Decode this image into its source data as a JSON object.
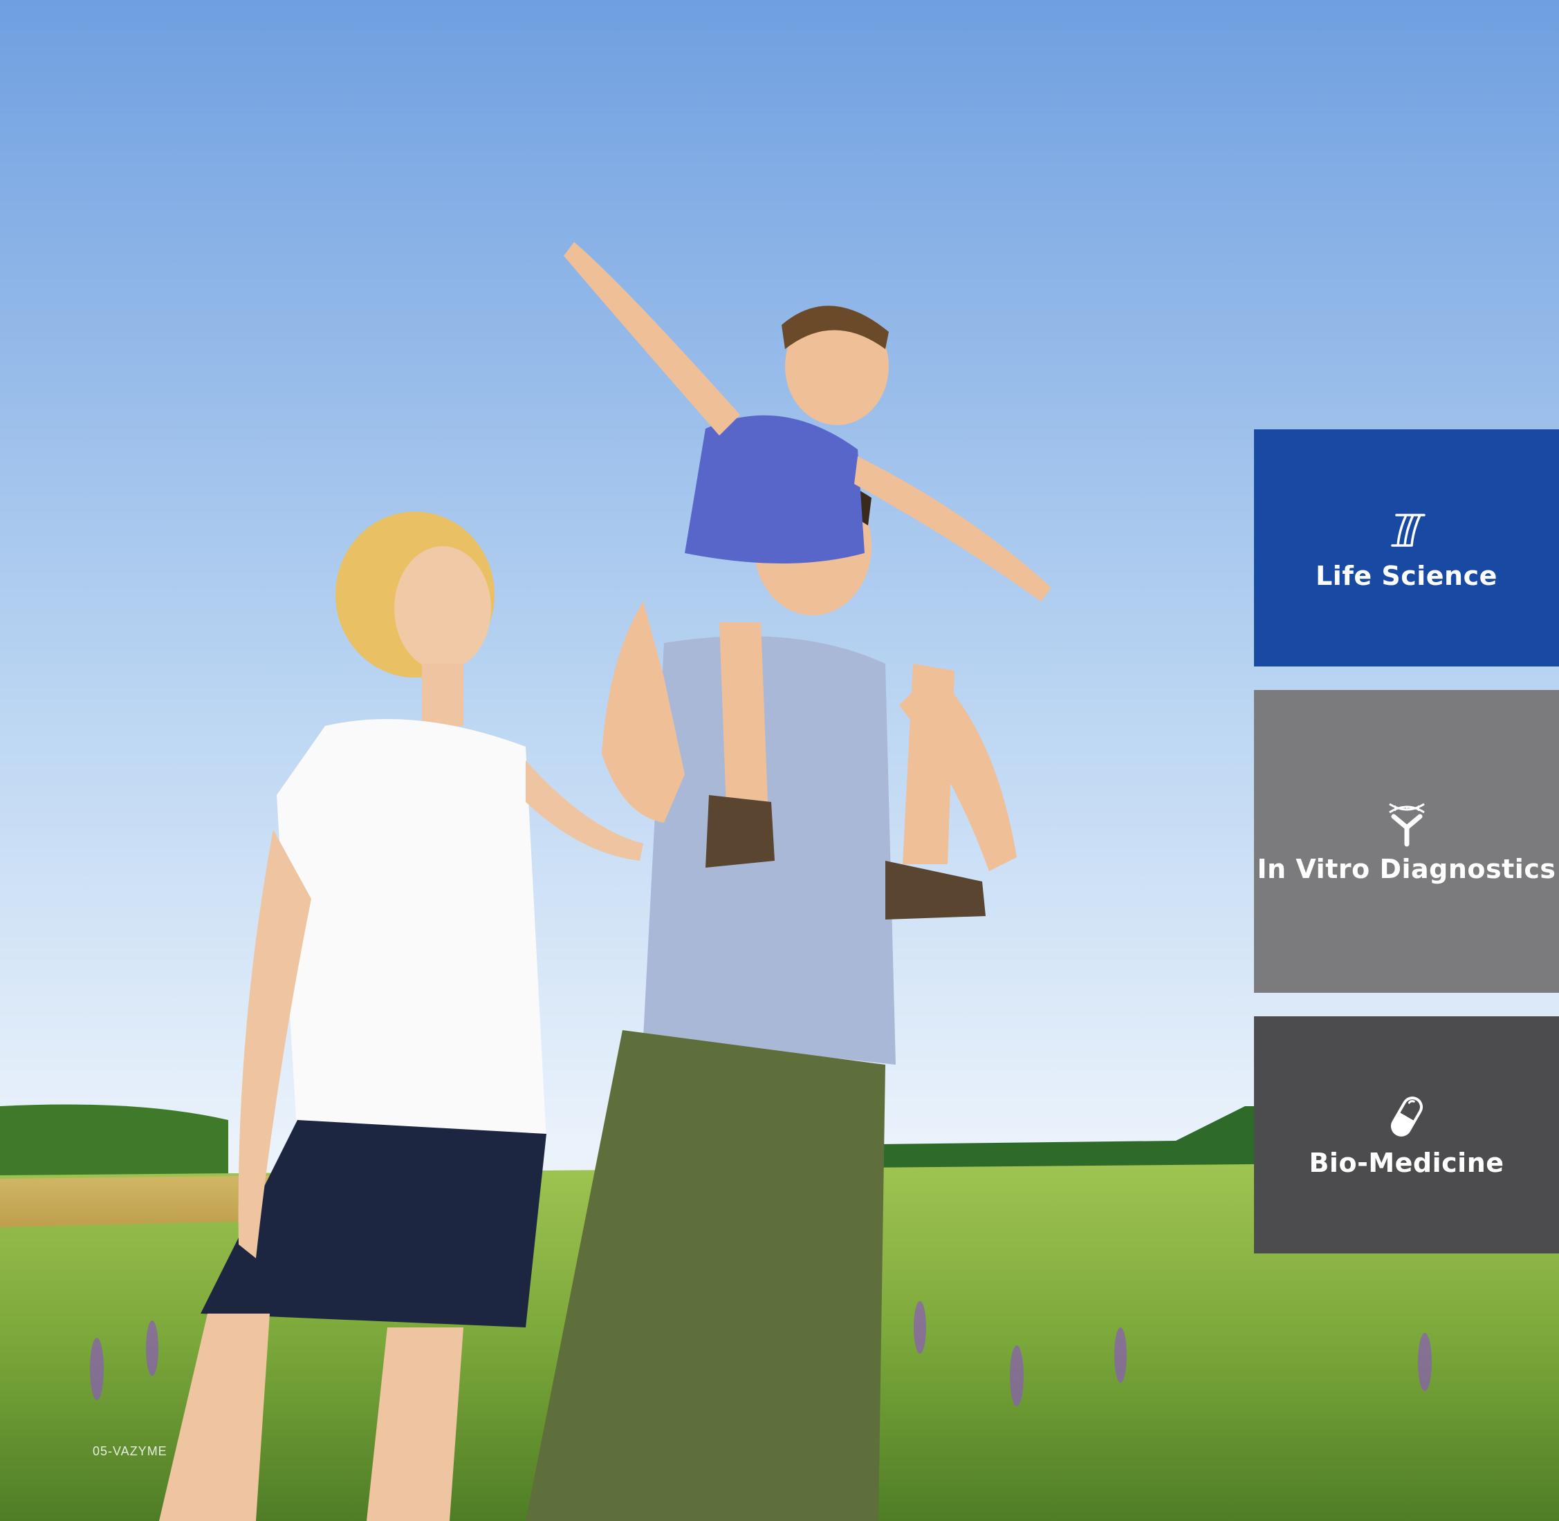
{
  "panels": [
    {
      "label": "Life Science",
      "icon": "life-science-icon",
      "color": "#1849a3"
    },
    {
      "label": "In Vitro Diagnostics",
      "icon": "dna-antibody-icon",
      "color": "#7b7b7d"
    },
    {
      "label": "Bio-Medicine",
      "icon": "capsule-icon",
      "color": "#4c4b4e"
    }
  ],
  "footer": {
    "folio": "05-VAZYME"
  },
  "photo": {
    "icon": "family-photo"
  }
}
